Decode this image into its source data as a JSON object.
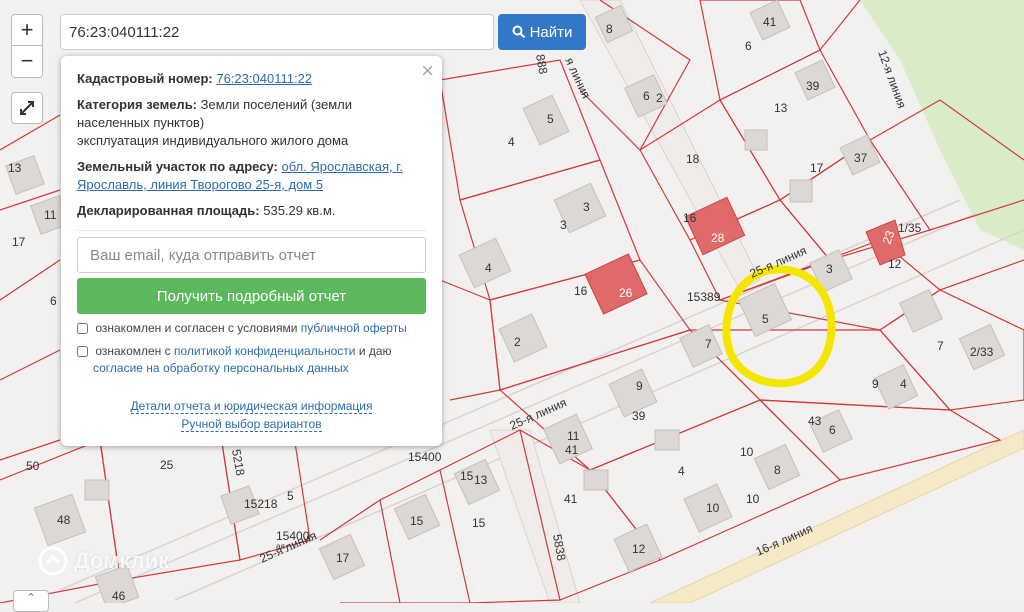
{
  "map": {
    "streets": [
      "12-я линия",
      "25-я линия",
      "25-я линия",
      "25-я линия",
      "16-я линия",
      "888",
      "5218",
      "5838"
    ],
    "parcels": [
      "76:23:040111:22",
      "15389",
      "15400",
      "15400",
      "15218",
      "28",
      "26",
      "23"
    ],
    "labels": [
      "6",
      "8",
      "41",
      "6",
      "2",
      "5",
      "4",
      "39",
      "13",
      "18",
      "37",
      "17",
      "3",
      "3",
      "16",
      "4",
      "16",
      "3",
      "1/35",
      "12",
      "13",
      "11",
      "17",
      "6",
      "15389",
      "7",
      "2",
      "5",
      "7",
      "2/33",
      "9",
      "39",
      "4",
      "9",
      "43",
      "6",
      "25",
      "5",
      "50",
      "15400",
      "11",
      "41",
      "13",
      "15",
      "4",
      "10",
      "8",
      "10",
      "10",
      "41",
      "15218",
      "48",
      "15",
      "15",
      "12",
      "17",
      "46"
    ],
    "colors": {
      "parcel_line": "#d33a3a",
      "highlight": "#f5e600",
      "built": "#e06a6a",
      "house": "#dcd8d4",
      "green": "#d9ecc8"
    }
  },
  "controls": {
    "zoom_in": "+",
    "zoom_out": "−",
    "fullscreen_icon": "expand-icon"
  },
  "search": {
    "value": "76:23:040111:22",
    "button_label": "Найти",
    "button_icon": "search-icon"
  },
  "panel": {
    "close_symbol": "×",
    "cadastral_label": "Кадастровый номер:",
    "cadastral_value": "76:23:040111:22",
    "category_label": "Категория земель:",
    "category_value": "Земли поселений (земли населенных пунктов)",
    "use_value": "эксплуатация индивидуального жилого дома",
    "address_label": "Земельный участок по адресу:",
    "address_value": "обл. Ярославская, г. Ярославль, линия Творогово 25-я, дом 5",
    "area_label": "Декларированная площадь:",
    "area_value": "535.29 кв.м.",
    "email_placeholder": "Ваш email, куда отправить отчет",
    "report_button": "Получить подробный отчет",
    "consent1_text": "ознакомлен и согласен с условиями",
    "consent1_link": "публичной оферты",
    "consent2_text_a": "ознакомлен с",
    "consent2_link_a": "политикой конфиденциальности",
    "consent2_text_b": "и даю",
    "consent2_link_b": "согласие на обработку персональных данных",
    "details_link": "Детали отчета и юридическая информация",
    "manual_link": "Ручной выбор вариантов"
  },
  "watermark": "Домклик"
}
